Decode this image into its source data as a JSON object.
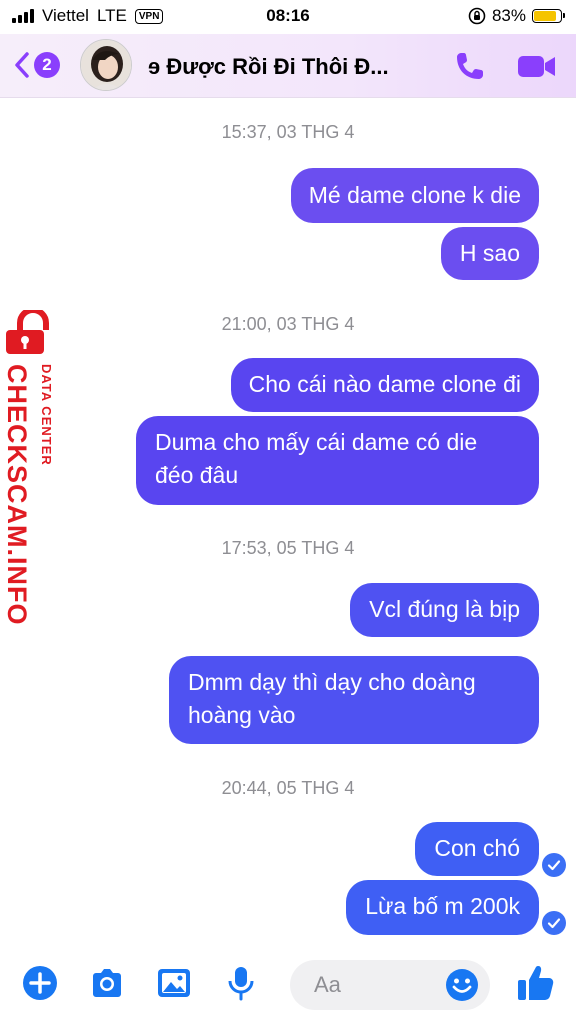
{
  "status_bar": {
    "carrier": "Viettel",
    "network": "LTE",
    "vpn": "VPN",
    "time": "08:16",
    "battery": "83%",
    "battery_level": 0.83
  },
  "header": {
    "back_badge": "2",
    "title": "ɘ Được Rồi Đi Thôi Đ..."
  },
  "watermark": {
    "brand": "CHECKSCAM.INFO",
    "sub": "DATA CENTER"
  },
  "messages": {
    "ts1": "15:37, 03 THG 4",
    "m1": "Mé dame clone k die",
    "m2": "H sao",
    "ts2": "21:00, 03 THG 4",
    "m3": "Cho cái nào dame clone đi",
    "m4a": "Duma cho mấy cái dame có die",
    "m4b": "đéo đâu",
    "ts3": "17:53, 05 THG 4",
    "m5": "Vcl đúng là bịp",
    "m6a": "Dmm dạy thì dạy cho doàng",
    "m6b": "hoàng vào",
    "ts4": "20:44, 05 THG 4",
    "m7": "Con chó",
    "m8": "Lừa bố m 200k"
  },
  "composer": {
    "placeholder": "Aa"
  },
  "colors": {
    "accent": "#8a3ffc",
    "bubble_top": "#6b4ef0",
    "bubble_bottom": "#3f5ff4",
    "watermark": "#e01b22"
  }
}
